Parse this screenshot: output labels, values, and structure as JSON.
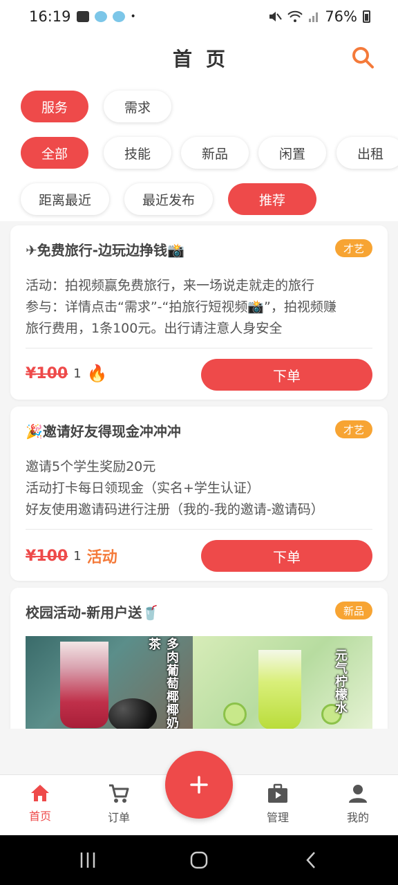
{
  "status_bar": {
    "time": "16:19",
    "dot": "•",
    "battery": "76%"
  },
  "header": {
    "title": "首页",
    "search_icon": "search-icon"
  },
  "category_tabs": [
    {
      "label": "服务",
      "active": true
    },
    {
      "label": "需求",
      "active": false
    }
  ],
  "type_filters": [
    {
      "label": "全部",
      "active": true
    },
    {
      "label": "技能",
      "active": false
    },
    {
      "label": "新品",
      "active": false
    },
    {
      "label": "闲置",
      "active": false
    },
    {
      "label": "出租",
      "active": false
    }
  ],
  "sort_options": [
    {
      "label": "距离最近",
      "active": false
    },
    {
      "label": "最近发布",
      "active": false
    },
    {
      "label": "推荐",
      "active": true
    }
  ],
  "cards": [
    {
      "title": "✈免费旅行-边玩边挣钱📸",
      "tag": "才艺",
      "description": [
        "活动：拍视频赢免费旅行，来一场说走就走的旅行",
        "参与：详情点击“需求”-“拍旅行短视频📸”，拍视频赚",
        "旅行费用，1条100元。出行请注意人身安全"
      ],
      "price": "¥100",
      "count": "1",
      "badge": "🔥",
      "order_label": "下单"
    },
    {
      "title": "🎉邀请好友得现金冲冲冲",
      "tag": "才艺",
      "description": [
        "邀请5个学生奖励20元",
        "活动打卡每日领现金（实名+学生认证）",
        "好友使用邀请码进行注册（我的-我的邀请-邀请码）"
      ],
      "price": "¥100",
      "count": "1",
      "badge": "活动",
      "order_label": "下单"
    },
    {
      "title": "校园活动-新用户送🥤",
      "tag": "新品",
      "banner_left_text": "多肉葡萄椰椰奶茶",
      "banner_right_text": "元气柠檬水"
    }
  ],
  "bottom_nav": [
    {
      "label": "首页",
      "icon": "home-icon",
      "active": true
    },
    {
      "label": "订单",
      "icon": "cart-icon",
      "active": false
    },
    {
      "label": "管理",
      "icon": "briefcase-play-icon",
      "active": false
    },
    {
      "label": "我的",
      "icon": "person-icon",
      "active": false
    }
  ],
  "fab_icon": "plus-icon",
  "colors": {
    "primary": "#ee4a4a",
    "tag_orange": "#f7a433",
    "activity_orange": "#f47a3a"
  }
}
